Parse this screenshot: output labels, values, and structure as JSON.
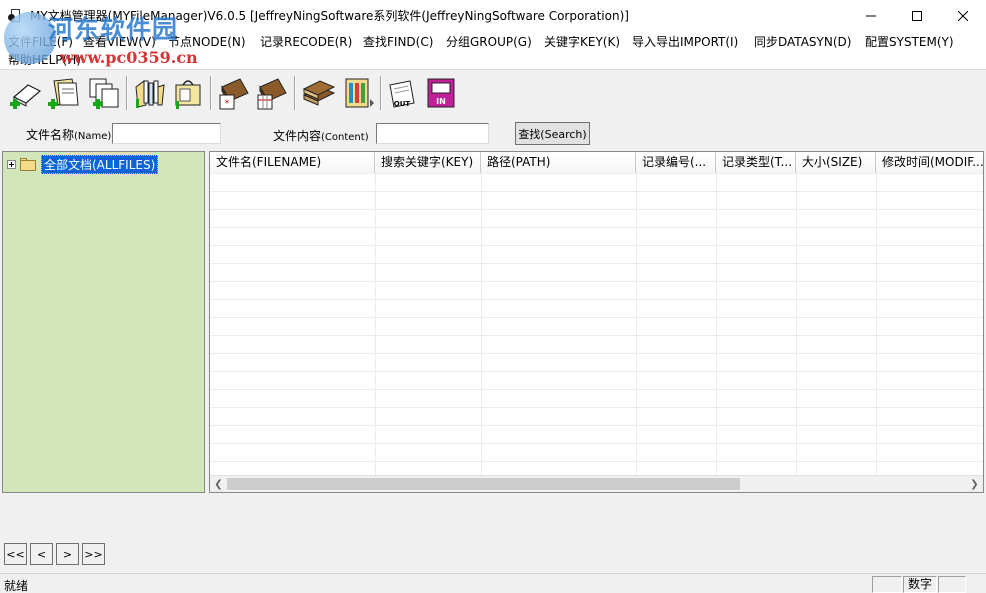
{
  "window": {
    "title": "MY文档管理器(MYFileManager)V6.0.5 [JeffreyNingSoftware系列软件(JeffreyNingSoftware Corporation)]",
    "controls": [
      "minimize-icon",
      "maximize-icon",
      "close-icon"
    ]
  },
  "watermark": {
    "title": "河东软件园",
    "url": "www.pc0359.cn"
  },
  "menu": {
    "items": [
      "文件FILE(F)",
      "查看VIEW(V)",
      "节点NODE(N)",
      "记录RECODE(R)",
      "查找FIND(C)",
      "分组GROUP(G)",
      "关键字KEY(K)",
      "导入导出IMPORT(I)",
      "同步DATASYN(D)",
      "配置SYSTEM(Y)",
      "帮助HELP(H)"
    ]
  },
  "toolbar": {
    "buttons": [
      "new-record-icon",
      "new-folder-icon",
      "copy-record-icon",
      "open-folder-icon",
      "document-bag-icon",
      "book-settings-icon",
      "book-calendar-icon",
      "books-stack-icon",
      "color-chart-icon",
      "export-out-icon",
      "import-in-icon"
    ],
    "export_label": "OUT",
    "import_label": "IN"
  },
  "search": {
    "name_label": "文件名称",
    "name_label_en": "(Name)",
    "name_value": "",
    "content_label": "文件内容",
    "content_label_en": "(Content)",
    "content_value": "",
    "search_button": "查找(Search)"
  },
  "tree": {
    "root_label": "全部文档(ALLFILES)",
    "background": "#d2e6ba",
    "selection_color": "#0a64d4"
  },
  "grid": {
    "columns": [
      "文件名(FILENAME)",
      "搜索关键字(KEY)",
      "路径(PATH)",
      "记录编号(...",
      "记录类型(T...",
      "大小(SIZE)",
      "修改时间(MODIF..."
    ],
    "rows": []
  },
  "pager": {
    "first": "<<",
    "prev": "<",
    "next": ">",
    "last": ">>"
  },
  "status": {
    "text": "就绪",
    "numlock": "数字"
  }
}
